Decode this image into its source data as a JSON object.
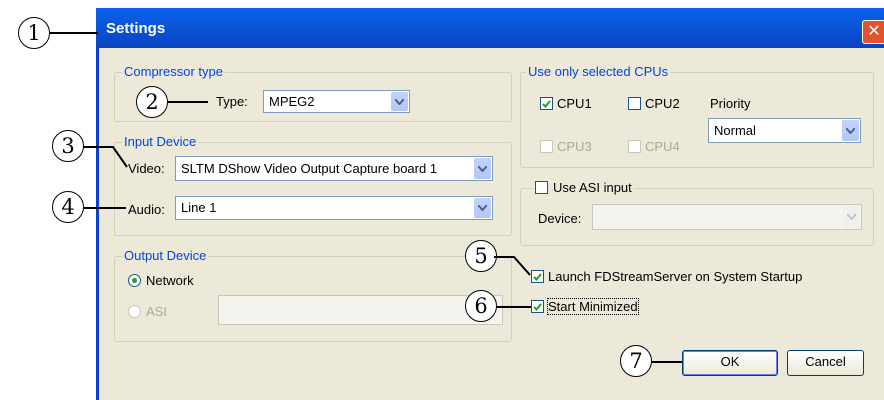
{
  "window": {
    "title": "Settings",
    "close_icon": "close-icon",
    "colors": {
      "titlebar": "#0a61ec",
      "face": "#ece9d8",
      "group_title": "#0046d5",
      "close": "#e3532d"
    }
  },
  "compressor": {
    "group_title": "Compressor type",
    "type_label": "Type:",
    "type_value": "MPEG2"
  },
  "input_device": {
    "group_title": "Input Device",
    "video_label": "Video:",
    "video_value": "SLTM DShow  Video Output Capture board 1",
    "audio_label": "Audio:",
    "audio_value": "Line 1"
  },
  "output_device": {
    "group_title": "Output Device",
    "network_label": "Network",
    "network_selected": true,
    "asi_label": "ASI",
    "asi_selected": false,
    "asi_value": ""
  },
  "cpus": {
    "group_title": "Use only selected CPUs",
    "cpu1": {
      "label": "CPU1",
      "checked": true,
      "enabled": true
    },
    "cpu2": {
      "label": "CPU2",
      "checked": false,
      "enabled": true
    },
    "cpu3": {
      "label": "CPU3",
      "checked": false,
      "enabled": false
    },
    "cpu4": {
      "label": "CPU4",
      "checked": false,
      "enabled": false
    },
    "priority_label": "Priority",
    "priority_value": "Normal"
  },
  "asi_input": {
    "checkbox_label": "Use ASI input",
    "checked": false,
    "device_label": "Device:",
    "device_value": ""
  },
  "options": {
    "launch_label": "Launch FDStreamServer on System Startup",
    "launch_checked": true,
    "minimized_label": "Start Minimized",
    "minimized_checked": true
  },
  "buttons": {
    "ok_label": "OK",
    "cancel_label": "Cancel"
  },
  "callouts": [
    "1",
    "2",
    "3",
    "4",
    "5",
    "6",
    "7"
  ]
}
